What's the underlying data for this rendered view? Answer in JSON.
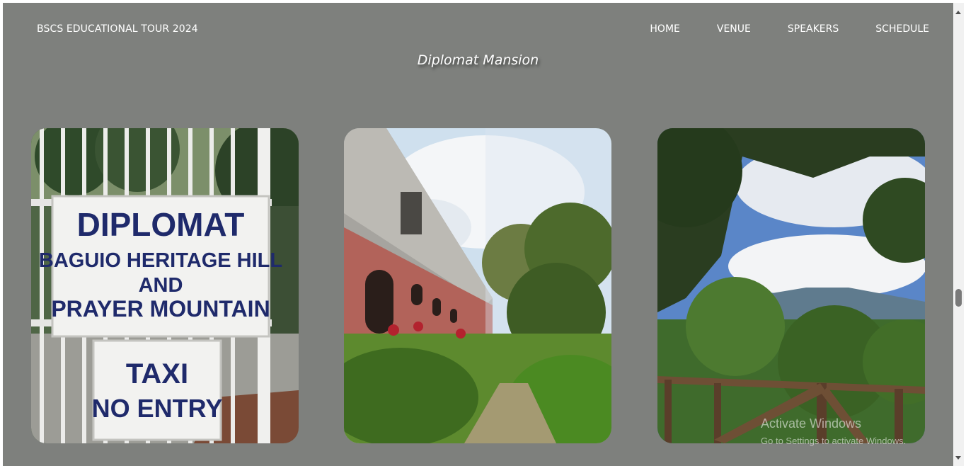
{
  "header": {
    "brand": "BSCS EDUCATIONAL TOUR 2024",
    "nav": [
      "HOME",
      "VENUE",
      "SPEAKERS",
      "SCHEDULE"
    ]
  },
  "main": {
    "title": "Diplomat Mansion"
  },
  "photos": {
    "sign1": [
      "DIPLOMAT",
      "BAGUIO HERITAGE HILL",
      "AND",
      "PRAYER MOUNTAIN"
    ],
    "sign2": [
      "TAXI",
      "NO ENTRY"
    ]
  },
  "watermark": {
    "line1": "Activate Windows",
    "line2": "Go to Settings to activate Windows."
  },
  "colors": {
    "page_bg": "#7e807d",
    "text": "#ffffff",
    "sign_text": "#1f2a6b"
  }
}
